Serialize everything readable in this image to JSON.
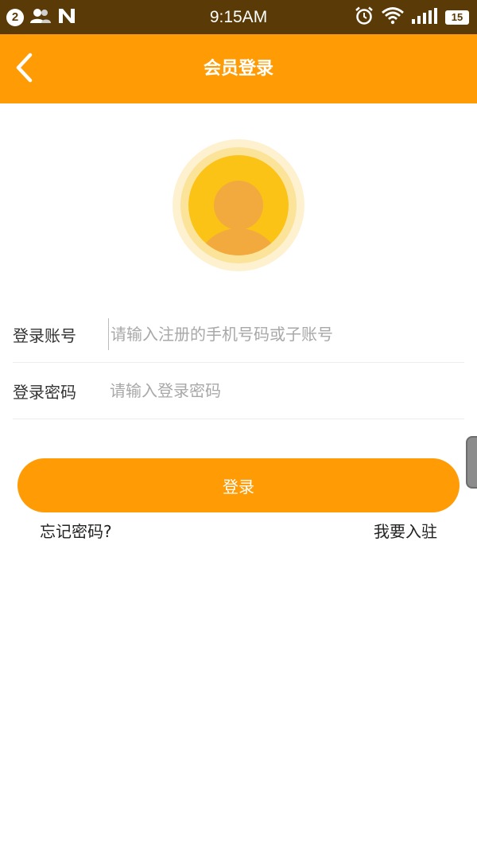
{
  "status_bar": {
    "notification_count": "2",
    "time": "9:15AM",
    "battery": "15",
    "icons": [
      "contacts-icon",
      "n-app-icon",
      "alarm-icon",
      "wifi-icon",
      "signal-icon",
      "battery-icon"
    ]
  },
  "nav": {
    "title": "会员登录",
    "back_icon": "chevron-left-icon"
  },
  "avatar": {
    "icon": "user-avatar-icon",
    "colors": {
      "outer": "#fdf1cf",
      "mid": "#fce39a",
      "inner": "#fbc316",
      "figure": "#f2aa3f"
    }
  },
  "form": {
    "account_label": "登录账号",
    "account_placeholder": "请输入注册的手机号码或子账号",
    "password_label": "登录密码",
    "password_placeholder": "请输入登录密码"
  },
  "actions": {
    "login_label": "登录",
    "forgot_password": "忘记密码?",
    "join": "我要入驻"
  },
  "colors": {
    "accent": "#ff9c05",
    "status_bar": "#5a3a06"
  }
}
